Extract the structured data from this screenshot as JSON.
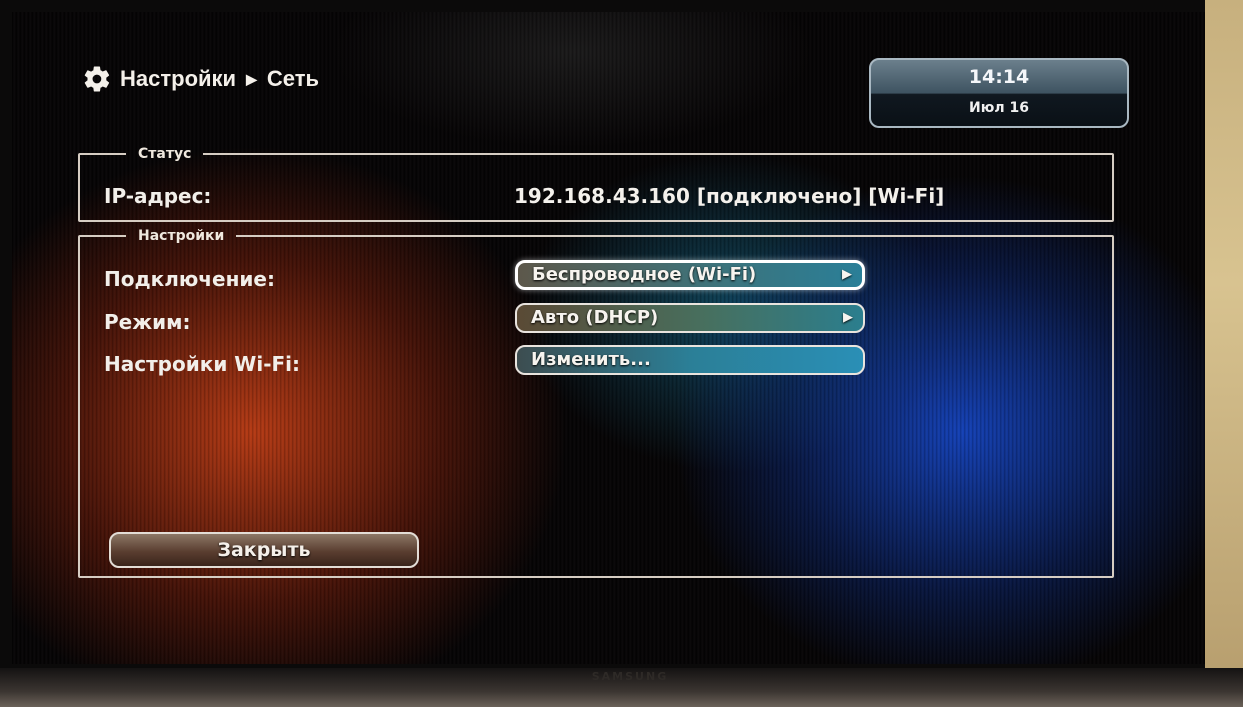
{
  "breadcrumb": {
    "icon": "gear-icon",
    "section": "Настройки",
    "separator": "▶",
    "page": "Сеть"
  },
  "clock": {
    "time": "14:14",
    "date": "Июл 16"
  },
  "status": {
    "legend": "Статус",
    "ip_label": "IP-адрес:",
    "ip_value": "192.168.43.160 [подключено] [Wi-Fi]"
  },
  "settings": {
    "legend": "Настройки",
    "rows": [
      {
        "label": "Подключение:",
        "value": "Беспроводное (Wi-Fi)",
        "arrow": "▶"
      },
      {
        "label": "Режим:",
        "value": "Авто (DHCP)",
        "arrow": "▶"
      },
      {
        "label": "Настройки Wi-Fi:",
        "value": "Изменить..."
      }
    ],
    "close_label": "Закрыть"
  },
  "device": {
    "brand": "SAMSUNG"
  }
}
